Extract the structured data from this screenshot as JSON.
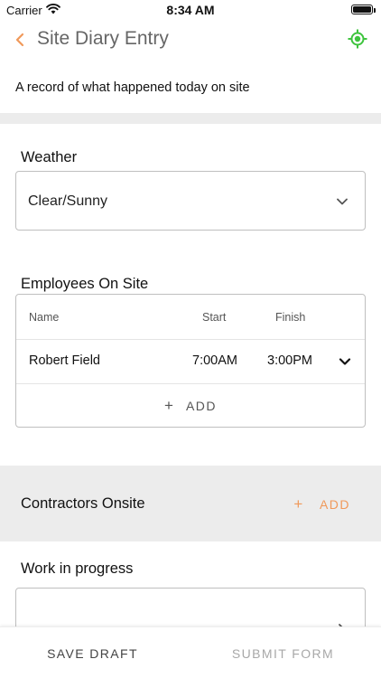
{
  "status_bar": {
    "carrier": "Carrier",
    "time": "8:34 AM",
    "icons": [
      "wifi-icon",
      "battery-icon"
    ]
  },
  "nav": {
    "title": "Site Diary Entry",
    "back_icon": "chevron-left-icon",
    "action_icon": "location-target-icon",
    "accent_color": "#f0995a",
    "action_color": "#3ec43e"
  },
  "description": "A record of what happened today on site",
  "weather": {
    "label": "Weather",
    "value": "Clear/Sunny",
    "icon": "chevron-down-icon"
  },
  "employees": {
    "label": "Employees On Site",
    "columns": [
      "Name",
      "Start",
      "Finish"
    ],
    "rows": [
      {
        "name": "Robert  Field",
        "start": "7:00AM",
        "finish": "3:00PM"
      }
    ],
    "add_label": "ADD",
    "add_icon": "plus-icon"
  },
  "contractors": {
    "label": "Contractors Onsite",
    "add_label": "ADD",
    "add_icon": "plus-icon",
    "accent_color": "#f0995a"
  },
  "work_in_progress": {
    "label": "Work in progress",
    "icon": "chevron-right-icon"
  },
  "actions": {
    "save_draft": "SAVE DRAFT",
    "submit_form": "SUBMIT FORM"
  }
}
